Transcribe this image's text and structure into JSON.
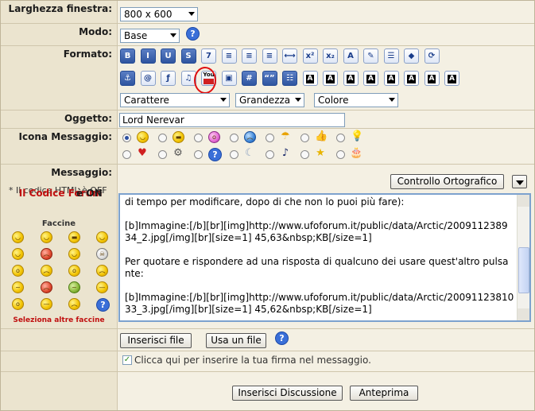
{
  "labels": {
    "width": "Larghezza finestra:",
    "mode": "Modo:",
    "format": "Formato:",
    "subject": "Oggetto:",
    "icon": "Icona Messaggio:",
    "message": "Messaggio:"
  },
  "width_select": {
    "value": "800 x 600"
  },
  "mode_select": {
    "value": "Base"
  },
  "help_glyph": "?",
  "toolbar": {
    "row1": [
      {
        "name": "bold-button",
        "text": "B",
        "style": "dark"
      },
      {
        "name": "italic-button",
        "text": "I",
        "style": "dark"
      },
      {
        "name": "underline-button",
        "text": "U",
        "style": "dark"
      },
      {
        "name": "strike-button",
        "text": "S",
        "style": "dark"
      },
      {
        "name": "font-button",
        "text": "7",
        "style": ""
      },
      {
        "name": "align-left-button",
        "text": "≡",
        "style": ""
      },
      {
        "name": "align-center-button",
        "text": "≡",
        "style": ""
      },
      {
        "name": "align-right-button",
        "text": "≡",
        "style": ""
      },
      {
        "name": "hr-button",
        "text": "⟷",
        "style": ""
      },
      {
        "name": "superscript-button",
        "text": "x²",
        "style": ""
      },
      {
        "name": "subscript-button",
        "text": "x₂",
        "style": ""
      },
      {
        "name": "typewriter-button",
        "text": "A",
        "style": ""
      },
      {
        "name": "highlight-button",
        "text": "✎",
        "style": ""
      },
      {
        "name": "marquee-button",
        "text": "☰",
        "style": ""
      },
      {
        "name": "glow-button",
        "text": "◆",
        "style": ""
      },
      {
        "name": "refresh-button",
        "text": "⟳",
        "style": ""
      }
    ],
    "row2": [
      {
        "name": "link-button",
        "text": "⚓",
        "style": "dark"
      },
      {
        "name": "email-button",
        "text": "@",
        "style": ""
      },
      {
        "name": "flash-button",
        "text": "ƒ",
        "style": ""
      },
      {
        "name": "music-button",
        "text": "♫",
        "style": ""
      },
      {
        "name": "youtube-button",
        "text": "You",
        "style": ""
      },
      {
        "name": "image-button",
        "text": "▣",
        "style": ""
      },
      {
        "name": "hash-button",
        "text": "#",
        "style": "dark"
      },
      {
        "name": "quote-button",
        "text": "“”",
        "style": "dark"
      },
      {
        "name": "list-button",
        "text": "☷",
        "style": "dark"
      },
      {
        "name": "letter-a1-button",
        "text": "A",
        "style": "blk"
      },
      {
        "name": "letter-a2-button",
        "text": "A",
        "style": "blk"
      },
      {
        "name": "letter-a3-button",
        "text": "A",
        "style": "blk"
      },
      {
        "name": "letter-a4-button",
        "text": "A",
        "style": "blk"
      },
      {
        "name": "letter-a5-button",
        "text": "A",
        "style": "blk"
      },
      {
        "name": "letter-a6-button",
        "text": "A",
        "style": "blk"
      },
      {
        "name": "letter-a7-button",
        "text": "A",
        "style": "blk"
      },
      {
        "name": "letter-a8-button",
        "text": "A",
        "style": "blk"
      }
    ]
  },
  "font_selects": {
    "character": "Carattere",
    "size": "Grandezza",
    "color": "Colore"
  },
  "subject": {
    "value": "Lord Nerevar"
  },
  "icons": {
    "row1": [
      "smile",
      "grin-glasses",
      "surprised",
      "cry",
      "rain",
      "thumb",
      "star",
      "bulb"
    ],
    "row2": [
      "heart",
      "gear",
      "question",
      "moon",
      "note",
      "star2",
      "cake"
    ]
  },
  "side_notes": {
    "html": "* Il codice HTML è OFF",
    "forum_prefix": "* ",
    "forum_link": "Il Codice Forum",
    "forum_suffix": " è ON"
  },
  "faces": {
    "title": "Faccine",
    "more": "Seleziona altre faccine"
  },
  "spellcheck": {
    "label": "Controllo Ortografico"
  },
  "message_text": "di tempo per modificare, dopo di che non lo puoi più fare):\n\n[b]Immagine:[/b][br][img]http://www.ufoforum.it/public/data/Arctic/2009112389 34_2.jpg[/img][br][size=1] 45,63&nbsp;KB[/size=1]\n\nPer quotare e rispondere ad una risposta di qualcuno dei usare quest'altro pulsante:\n\n[b]Immagine:[/b][br][img]http://www.ufoforum.it/public/data/Arctic/2009112381033_3.jpg[/img][br][size=1] 45,62&nbsp;KB[/size=1]\n\nInfine per inserire i video di youtube, basta che copi l'indirizzo del video, lo evidenzi e premi",
  "attach": {
    "insert_file": "Inserisci file",
    "use_file": "Usa un file"
  },
  "signature": {
    "label": "Clicca qui per inserire la tua firma nel messaggio."
  },
  "submit": {
    "insert": "Inserisci Discussione",
    "preview": "Anteprima"
  },
  "colors": {
    "accent": "#3a6fd8",
    "link": "#c01010",
    "border": "#7da2ce"
  }
}
